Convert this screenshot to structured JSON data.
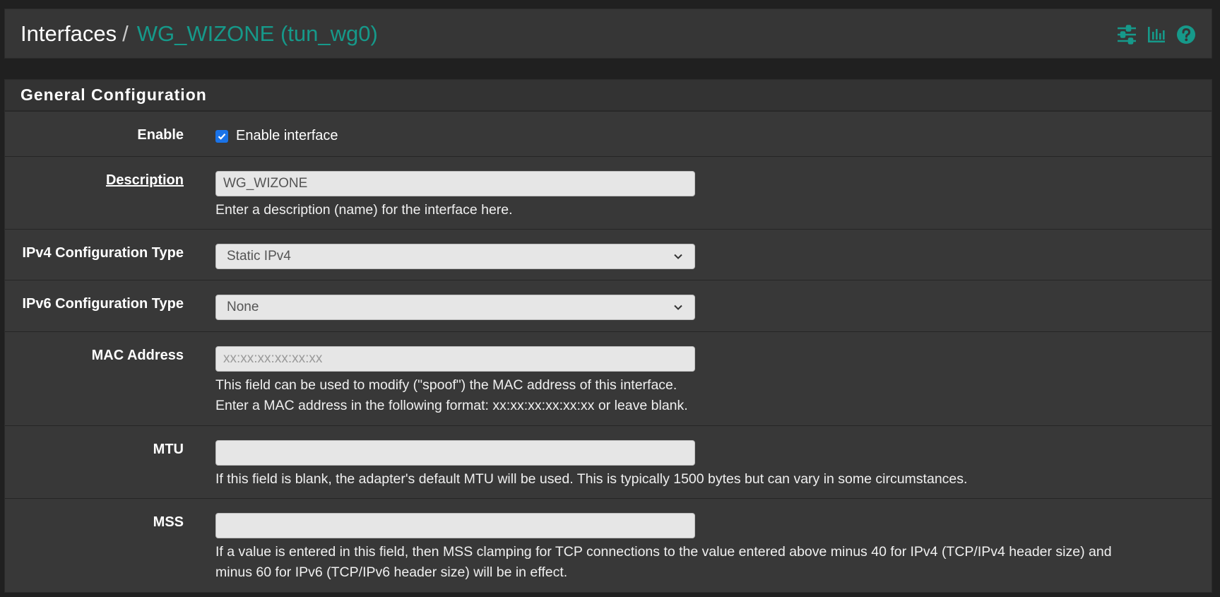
{
  "breadcrumb": {
    "root": "Interfaces",
    "separator": "/",
    "current": "WG_WIZONE (tun_wg0)"
  },
  "header_icons": [
    "sliders-icon",
    "bar-chart-icon",
    "help-icon"
  ],
  "accent_color": "#16998a",
  "panel": {
    "title": "General Configuration"
  },
  "enable": {
    "label": "Enable",
    "checkbox_label": "Enable interface",
    "checked": true
  },
  "description": {
    "label": "Description",
    "value": "WG_WIZONE",
    "help": "Enter a description (name) for the interface here."
  },
  "ipv4_type": {
    "label": "IPv4 Configuration Type",
    "selected": "Static IPv4"
  },
  "ipv6_type": {
    "label": "IPv6 Configuration Type",
    "selected": "None"
  },
  "mac": {
    "label": "MAC Address",
    "placeholder": "xx:xx:xx:xx:xx:xx",
    "help_1": "This field can be used to modify (\"spoof\") the MAC address of this interface.",
    "help_2": "Enter a MAC address in the following format: xx:xx:xx:xx:xx:xx or leave blank."
  },
  "mtu": {
    "label": "MTU",
    "value": "",
    "help": "If this field is blank, the adapter's default MTU will be used. This is typically 1500 bytes but can vary in some circumstances."
  },
  "mss": {
    "label": "MSS",
    "value": "",
    "help_1": "If a value is entered in this field, then MSS clamping for TCP connections to the value entered above minus 40 for IPv4 (TCP/IPv4 header size) and",
    "help_2": "minus 60 for IPv6 (TCP/IPv6 header size) will be in effect."
  }
}
